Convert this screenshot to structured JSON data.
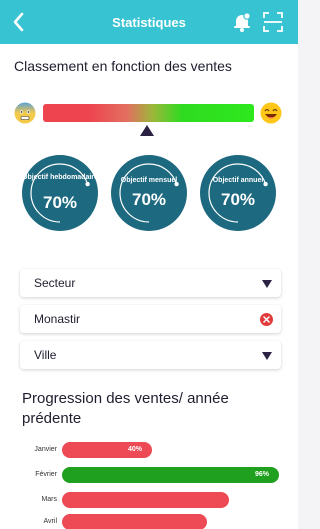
{
  "header": {
    "title": "Statistiques",
    "back_icon": "chevron-left-icon",
    "bell_icon": "bell-icon",
    "scan_icon": "scan-icon",
    "background": "#37c3d2"
  },
  "ranking": {
    "title": "Classement en fonction des ventes",
    "gauge_level": 0.5,
    "left_emoji": "anxious-face-icon",
    "right_emoji": "smiling-face-icon"
  },
  "objectives": [
    {
      "label": "Objectif hebdomadaire",
      "value": "70%",
      "progress": 0.7
    },
    {
      "label": "Objectif mensuel",
      "value": "70%",
      "progress": 0.7
    },
    {
      "label": "Objectif annuel",
      "value": "70%",
      "progress": 0.7
    }
  ],
  "filters": {
    "sector": "Secteur",
    "location": "Monastir",
    "city": "Ville"
  },
  "progression": {
    "title": "Progression des ventes/ année prédente",
    "colors": {
      "red": "#ee4a55",
      "green": "#1fa01f"
    },
    "rows": [
      {
        "month": "Janvier",
        "value": 40,
        "label": "40%",
        "color": "red"
      },
      {
        "month": "Février",
        "value": 96,
        "label": "96%",
        "color": "green"
      },
      {
        "month": "Mars",
        "value": 74,
        "label": "",
        "color": "red"
      },
      {
        "month": "Avril",
        "value": 64,
        "label": "",
        "color": "red"
      }
    ]
  }
}
